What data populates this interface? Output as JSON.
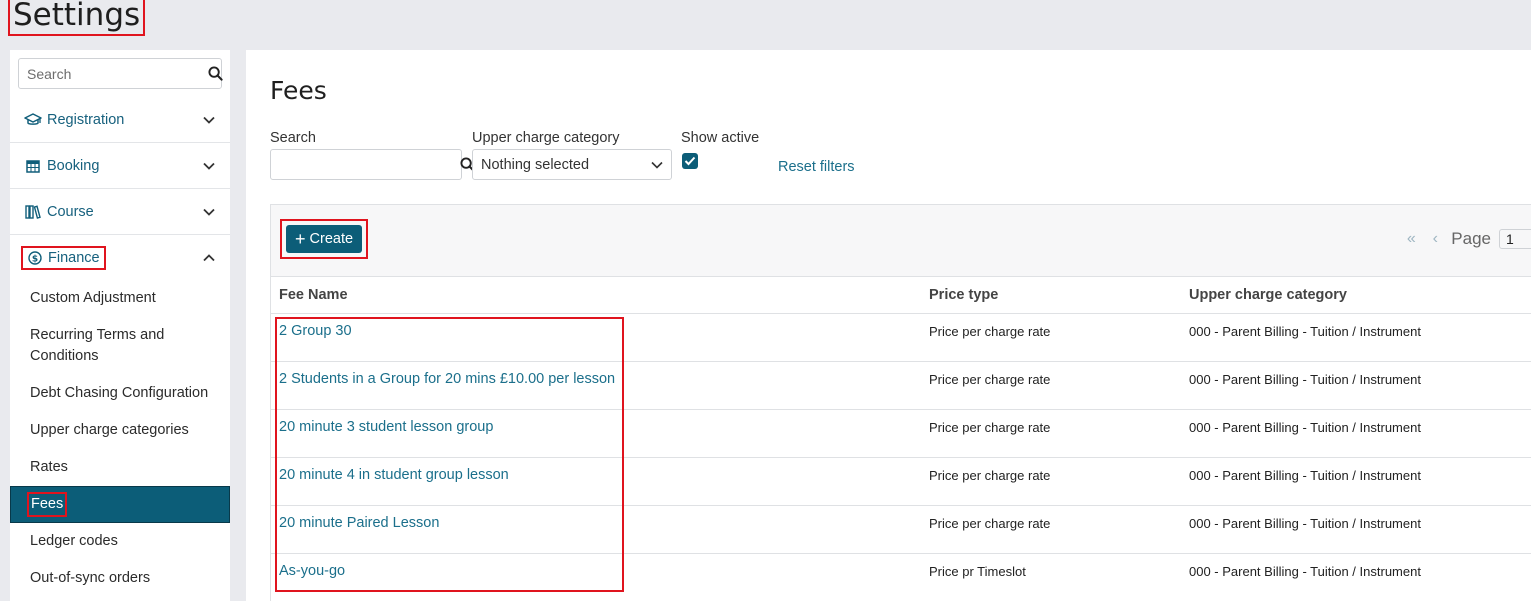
{
  "page": {
    "title": "Settings"
  },
  "sidebar": {
    "search_placeholder": "Search",
    "sections": [
      {
        "label": "Registration",
        "icon": "graduation-cap-icon",
        "expanded": false
      },
      {
        "label": "Booking",
        "icon": "calendar-icon",
        "expanded": false
      },
      {
        "label": "Course",
        "icon": "books-icon",
        "expanded": false
      },
      {
        "label": "Finance",
        "icon": "dollar-circle-icon",
        "expanded": true
      }
    ],
    "finance_items": [
      "Custom Adjustment",
      "Recurring Terms and Conditions",
      "Debt Chasing Configuration",
      "Upper charge categories",
      "Rates",
      "Fees",
      "Ledger codes",
      "Out-of-sync orders"
    ],
    "active_item": "Fees"
  },
  "main": {
    "title": "Fees",
    "filters": {
      "search_label": "Search",
      "search_value": "",
      "category_label": "Upper charge category",
      "category_value": "Nothing selected",
      "active_label": "Show active",
      "active_checked": true,
      "reset_label": "Reset filters"
    },
    "toolbar": {
      "create_label": "Create"
    },
    "pager": {
      "first": "«",
      "prev": "‹",
      "label": "Page",
      "value": "1"
    },
    "table": {
      "headers": [
        "Fee Name",
        "Price type",
        "Upper charge category"
      ],
      "rows": [
        [
          "2 Group 30",
          "Price per charge rate",
          "000 - Parent Billing - Tuition / Instrument"
        ],
        [
          "2 Students in a Group for 20 mins £10.00 per lesson",
          "Price per charge rate",
          "000 - Parent Billing - Tuition / Instrument"
        ],
        [
          "20 minute 3 student lesson group",
          "Price per charge rate",
          "000 - Parent Billing - Tuition / Instrument"
        ],
        [
          "20 minute 4 in student group lesson",
          "Price per charge rate",
          "000 - Parent Billing - Tuition / Instrument"
        ],
        [
          "20 minute Paired Lesson",
          "Price per charge rate",
          "000 - Parent Billing - Tuition / Instrument"
        ],
        [
          "As-you-go",
          "Price pr Timeslot",
          "000 - Parent Billing - Tuition / Instrument"
        ]
      ]
    }
  },
  "colors": {
    "accent": "#0c5d78",
    "link": "#1b6f8b",
    "highlight": "#e0141e"
  }
}
